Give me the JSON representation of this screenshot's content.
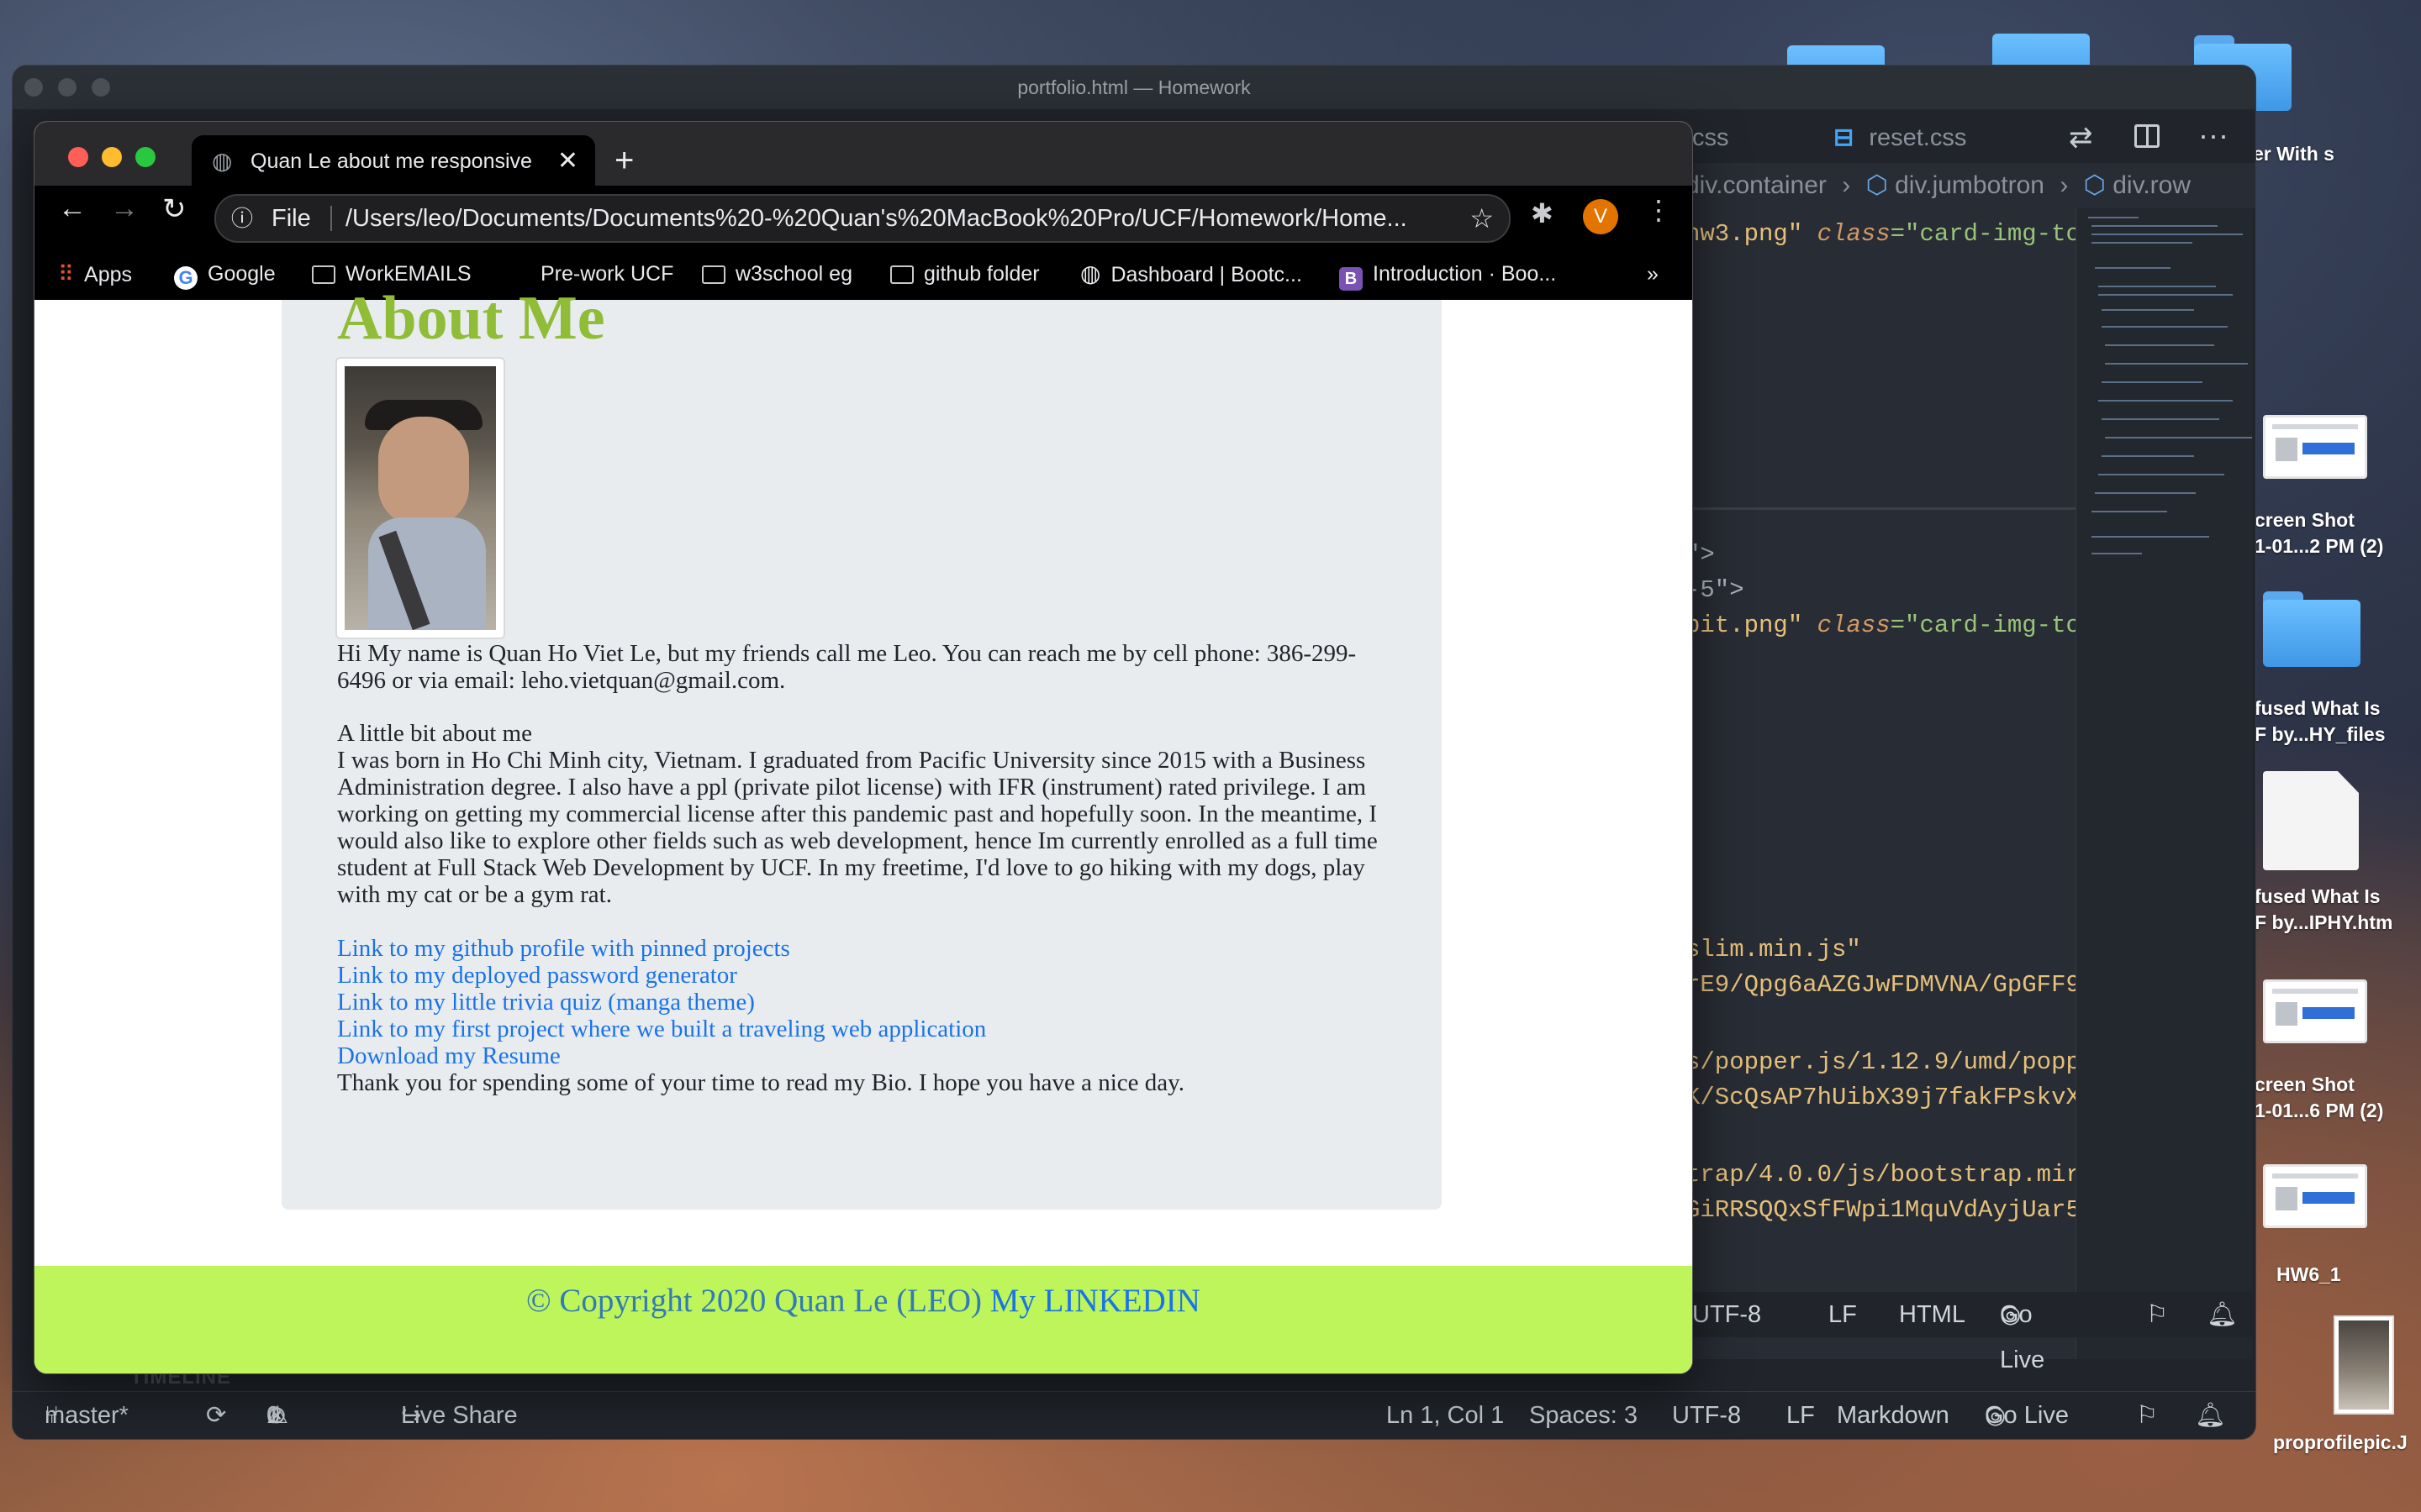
{
  "vscode": {
    "window_title": "portfolio.html — Homework",
    "tabs": [
      "css",
      "reset.css"
    ],
    "breadcrumb": [
      "div.container",
      "div.jumbotron",
      "div.row"
    ],
    "code_lines": [
      {
        "a": "hw3.png\"",
        "b": "class",
        "c": "=\"card-img-to"
      },
      {
        "a": "\">",
        "b": "",
        "c": ""
      },
      {
        "a": "-5\">",
        "b": "",
        "c": ""
      },
      {
        "a": "pit.png\"",
        "b": "class",
        "c": "=\"card-img-to"
      },
      {
        "a": "slim.min.js\"",
        "b": "",
        "c": ""
      },
      {
        "a": "rE9/Qpg6aAZGJwFDMVNA/GpGFF9",
        "b": "",
        "c": ""
      },
      {
        "a": "s/popper.js/1.12.9/umd/popp",
        "b": "",
        "c": ""
      },
      {
        "a": "K/ScQsAP7hUibX39j7fakFPskvX",
        "b": "",
        "c": ""
      },
      {
        "a": "trap/4.0.0/js/bootstrap.mir",
        "b": "",
        "c": ""
      },
      {
        "a": "GiRRSQQxSfFWpi1MquVdAyjUar5",
        "b": "",
        "c": ""
      }
    ],
    "inner_status": [
      "UTF-8",
      "LF",
      "HTML",
      "Go Live"
    ],
    "timeline_label": "TIMELINE",
    "status": {
      "branch": "master*",
      "errors": "0",
      "warnings": "1",
      "live_share": "Live Share",
      "position": "Ln 1, Col 1",
      "spaces": "Spaces: 3",
      "encoding": "UTF-8",
      "eol": "LF",
      "language": "Markdown",
      "go_live": "Go Live"
    }
  },
  "desktop": {
    "labels": [
      "er With\ns",
      "creen Shot\n1-01...2 PM (2)",
      "fused What Is\nF by...HY_files",
      "fused What Is\nF by...IPHY.htm",
      "creen Shot\n1-01...6 PM (2)",
      "HW6_1",
      "proprofilepic.J"
    ]
  },
  "chrome": {
    "tab_title": "Quan Le about me responsive p",
    "url_scheme": "File",
    "url": "/Users/leo/Documents/Documents%20-%20Quan's%20MacBook%20Pro/UCF/Homework/Home...",
    "profile_initial": "V",
    "bookmarks": [
      "Apps",
      "Google",
      "WorkEMAILS",
      "Pre-work UCF",
      "w3school eg",
      "github folder",
      "Dashboard | Bootc...",
      "Introduction · Boo..."
    ],
    "more_bookmarks": "»"
  },
  "page": {
    "heading": "About Me",
    "intro": "Hi My name is Quan Ho Viet Le, but my friends call me Leo. You can reach me by cell phone: 386-299-6496 or via email: leho.vietquan@gmail.com.",
    "subheading": "A little bit about me",
    "bio": "I was born in Ho Chi Minh city, Vietnam. I graduated from Pacific University since 2015 with a Business Administration degree. I also have a ppl (private pilot license) with IFR (instrument) rated privilege. I am working on getting my commercial license after this pandemic past and hopefully soon. In the meantime, I would also like to explore other fields such as web development, hence Im currently enrolled as a full time student at Full Stack Web Development by UCF. In my freetime, I'd love to go hiking with my dogs, play with my cat or be a gym rat.",
    "links": [
      "Link to my github profile with pinned projects",
      "Link to my deployed password generator",
      "Link to my little trivia quiz (manga theme)",
      "Link to my first project where we built a traveling web application",
      "Download my Resume"
    ],
    "closing": "Thank you for spending some of your time to read my Bio. I hope you have a nice day.",
    "footer_text": "© Copyright 2020 Quan Le (LEO)",
    "footer_link": "My LINKEDIN"
  },
  "colors": {
    "heading": "#8fbd37",
    "footer_bg": "#bdf55a",
    "link": "#1a73e8",
    "jumbotron_bg": "#e9ecef"
  }
}
